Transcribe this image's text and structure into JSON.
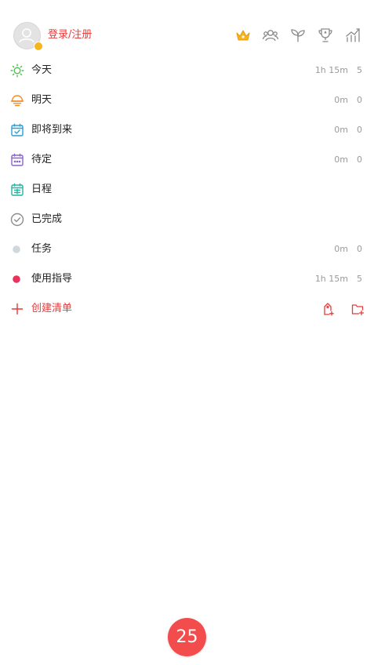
{
  "header": {
    "login_label": "登录/注册",
    "icons": [
      "crown-icon",
      "team-icon",
      "sprout-icon",
      "trophy-icon",
      "stats-icon"
    ]
  },
  "lists": [
    {
      "label": "今天",
      "duration": "1h 15m",
      "count": "5",
      "icon": "sun-icon",
      "color": "#4cbf4c"
    },
    {
      "label": "明天",
      "duration": "0m",
      "count": "0",
      "icon": "sunrise-icon",
      "color": "#f28c28"
    },
    {
      "label": "即将到来",
      "duration": "0m",
      "count": "0",
      "icon": "calendar-check-icon",
      "color": "#2a9fd6"
    },
    {
      "label": "待定",
      "duration": "0m",
      "count": "0",
      "icon": "calendar-dots-icon",
      "color": "#8a63d2"
    },
    {
      "label": "日程",
      "duration": "",
      "count": "",
      "icon": "calendar-grid-icon",
      "color": "#26b3a3"
    },
    {
      "label": "已完成",
      "duration": "",
      "count": "",
      "icon": "check-circle-icon",
      "color": "#8c8c8c"
    },
    {
      "label": "任务",
      "duration": "0m",
      "count": "0",
      "icon": "dot-icon",
      "color": "#cfd8dc"
    },
    {
      "label": "使用指导",
      "duration": "1h 15m",
      "count": "5",
      "icon": "dot-icon",
      "color": "#e8345d"
    }
  ],
  "create": {
    "label": "创建清单",
    "color": "#e83a3a"
  },
  "pomodoro": {
    "value": "25",
    "color": "#f24c4c"
  }
}
